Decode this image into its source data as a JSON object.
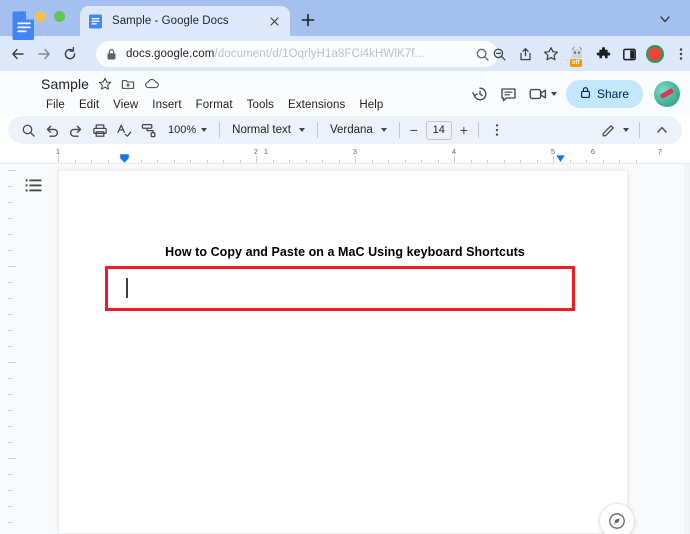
{
  "browser": {
    "traffic_lights": [
      "close",
      "minimize",
      "maximize"
    ],
    "tab": {
      "title": "Sample - Google Docs",
      "favicon": "google-docs-icon",
      "close_label": "×"
    },
    "new_tab_label": "+",
    "window_menu_icon": "chevron-down-icon",
    "nav": {
      "back_icon": "back-arrow-icon",
      "forward_icon": "forward-arrow-icon",
      "reload_icon": "reload-icon"
    },
    "omnibox": {
      "lock_icon": "lock-icon",
      "url_domain": "docs.google.com",
      "url_path": "/document/d/1OqrlyH1a8FCi4kHWlK7f...",
      "search_icon": "search-icon"
    },
    "toolbar_icons": [
      {
        "name": "zoom-out-icon",
        "label": ""
      },
      {
        "name": "share-icon",
        "label": ""
      },
      {
        "name": "bookmark-star-icon",
        "label": ""
      },
      {
        "name": "extension-badge-icon",
        "badge": "off"
      },
      {
        "name": "puzzle-extensions-icon",
        "label": ""
      },
      {
        "name": "side-panel-icon",
        "label": ""
      },
      {
        "name": "screen-record-icon",
        "label": ""
      },
      {
        "name": "chrome-menu-icon",
        "label": ""
      }
    ]
  },
  "docs": {
    "logo_icon": "google-docs-logo",
    "title": "Sample",
    "title_icons": [
      "star-icon",
      "move-to-folder-icon",
      "cloud-saved-icon"
    ],
    "menus": [
      "File",
      "Edit",
      "View",
      "Insert",
      "Format",
      "Tools",
      "Extensions",
      "Help"
    ],
    "header_right": {
      "history_icon": "version-history-icon",
      "comment_icon": "comment-icon",
      "meet_icon": "video-camera-icon",
      "share_label": "Share",
      "share_lock_icon": "lock-icon",
      "avatar": "user-avatar"
    },
    "toolbar": {
      "icons": [
        "search-icon",
        "undo-icon",
        "redo-icon",
        "print-icon",
        "spelling-check-icon",
        "paint-format-icon"
      ],
      "zoom_value": "100%",
      "style_value": "Normal text",
      "font_value": "Verdana",
      "font_size": "14",
      "decrease_label": "−",
      "increase_label": "+",
      "overflow_icon": "more-options-icon",
      "mode_icon": "editing-mode-pencil-icon",
      "collapse_icon": "chevron-up-icon"
    },
    "ruler": {
      "numbers": [
        "1",
        "2",
        "3",
        "4",
        "5",
        "6",
        "7"
      ],
      "left_margin_marker": "indent-marker",
      "right_margin_marker": "indent-marker"
    },
    "outline_icon": "document-outline-icon",
    "explore_icon": "explore-icon"
  },
  "document": {
    "heading": "How to Copy and Paste on a MaC Using keyboard Shortcuts",
    "annotation_color": "#ee1c25",
    "cursor_visible": true,
    "body_text": ""
  }
}
